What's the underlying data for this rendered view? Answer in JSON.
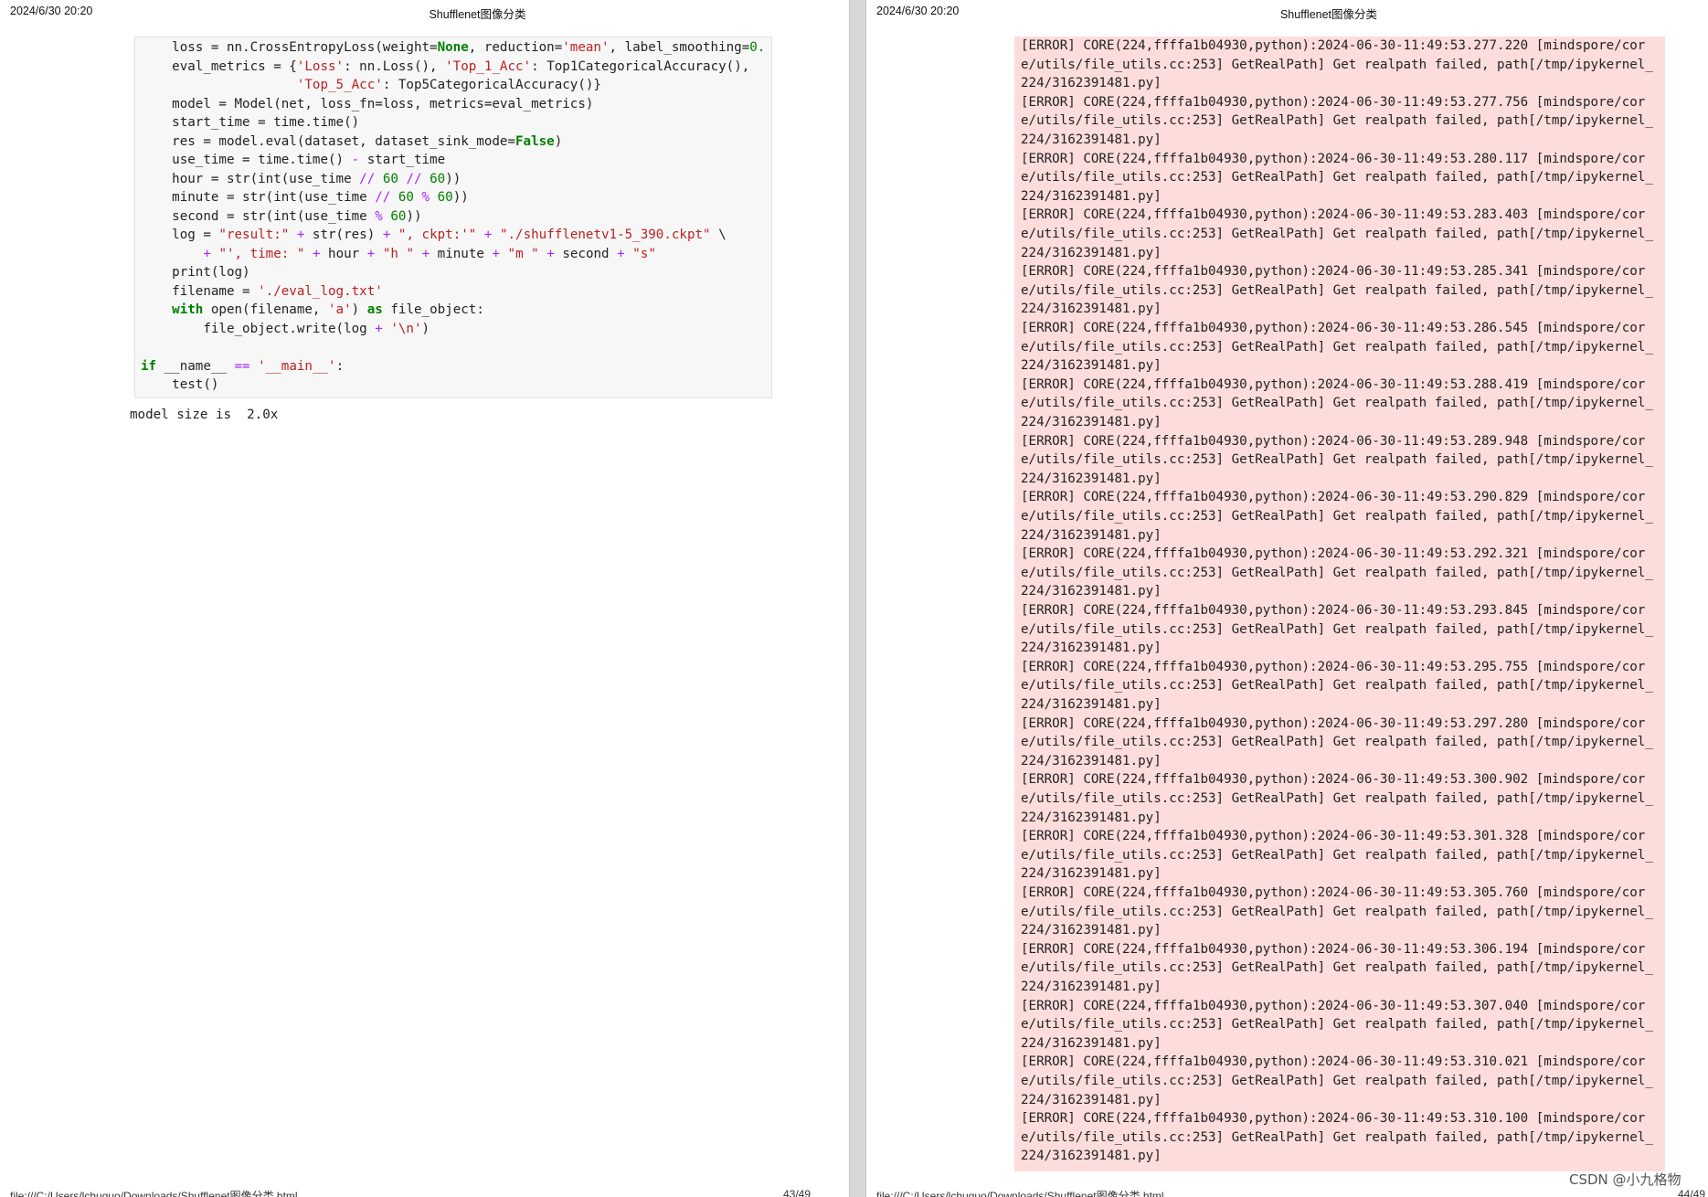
{
  "left_page": {
    "date": "2024/6/30 20:20",
    "title": "Shufflenet图像分类",
    "footer_url": "file:///C:/Users/lchuguo/Downloads/Shufflenet图像分类.html",
    "footer_page": "43/49",
    "code_lines": [
      [
        [
          "    loss = nn.CrossEntropyLoss(weight=",
          ""
        ],
        [
          "None",
          "kw"
        ],
        [
          ", reduction=",
          ""
        ],
        [
          "'mean'",
          "str"
        ],
        [
          ", label_smoothing=",
          ""
        ],
        [
          "0.",
          "num"
        ]
      ],
      [
        [
          "    eval_metrics = {",
          ""
        ],
        [
          "'Loss'",
          "str"
        ],
        [
          ": nn.Loss(), ",
          ""
        ],
        [
          "'Top_1_Acc'",
          "str"
        ],
        [
          ": Top1CategoricalAccuracy(),",
          ""
        ]
      ],
      [
        [
          "                    ",
          ""
        ],
        [
          "'Top_5_Acc'",
          "str"
        ],
        [
          ": Top5CategoricalAccuracy()}",
          ""
        ]
      ],
      [
        [
          "    model = Model(net, loss_fn=loss, metrics=eval_metrics)",
          ""
        ]
      ],
      [
        [
          "    start_time = time.time()",
          ""
        ]
      ],
      [
        [
          "    res = model.eval(dataset, dataset_sink_mode=",
          ""
        ],
        [
          "False",
          "kw"
        ],
        [
          ")",
          ""
        ]
      ],
      [
        [
          "    use_time = time.time() ",
          ""
        ],
        [
          "-",
          "op"
        ],
        [
          " start_time",
          ""
        ]
      ],
      [
        [
          "    hour = str(int(use_time ",
          ""
        ],
        [
          "//",
          "op"
        ],
        [
          " ",
          ""
        ],
        [
          "60",
          "num"
        ],
        [
          " ",
          ""
        ],
        [
          "//",
          "op"
        ],
        [
          " ",
          ""
        ],
        [
          "60",
          "num"
        ],
        [
          "))",
          ""
        ]
      ],
      [
        [
          "    minute = str(int(use_time ",
          ""
        ],
        [
          "//",
          "op"
        ],
        [
          " ",
          ""
        ],
        [
          "60",
          "num"
        ],
        [
          " ",
          ""
        ],
        [
          "%",
          "op"
        ],
        [
          " ",
          ""
        ],
        [
          "60",
          "num"
        ],
        [
          "))",
          ""
        ]
      ],
      [
        [
          "    second = str(int(use_time ",
          ""
        ],
        [
          "%",
          "op"
        ],
        [
          " ",
          ""
        ],
        [
          "60",
          "num"
        ],
        [
          "))",
          ""
        ]
      ],
      [
        [
          "    log = ",
          ""
        ],
        [
          "\"result:\"",
          "str"
        ],
        [
          " ",
          ""
        ],
        [
          "+",
          "op"
        ],
        [
          " str(res) ",
          ""
        ],
        [
          "+",
          "op"
        ],
        [
          " ",
          ""
        ],
        [
          "\", ckpt:'\"",
          "str"
        ],
        [
          " ",
          ""
        ],
        [
          "+",
          "op"
        ],
        [
          " ",
          ""
        ],
        [
          "\"./shufflenetv1-5_390.ckpt\"",
          "str"
        ],
        [
          " \\",
          ""
        ]
      ],
      [
        [
          "        ",
          ""
        ],
        [
          "+",
          "op"
        ],
        [
          " ",
          ""
        ],
        [
          "\"', time: \"",
          "str"
        ],
        [
          " ",
          ""
        ],
        [
          "+",
          "op"
        ],
        [
          " hour ",
          ""
        ],
        [
          "+",
          "op"
        ],
        [
          " ",
          ""
        ],
        [
          "\"h \"",
          "str"
        ],
        [
          " ",
          ""
        ],
        [
          "+",
          "op"
        ],
        [
          " minute ",
          ""
        ],
        [
          "+",
          "op"
        ],
        [
          " ",
          ""
        ],
        [
          "\"m \"",
          "str"
        ],
        [
          " ",
          ""
        ],
        [
          "+",
          "op"
        ],
        [
          " second ",
          ""
        ],
        [
          "+",
          "op"
        ],
        [
          " ",
          ""
        ],
        [
          "\"s\"",
          "str"
        ]
      ],
      [
        [
          "    print(log)",
          ""
        ]
      ],
      [
        [
          "    filename = ",
          ""
        ],
        [
          "'./eval_log.txt'",
          "str"
        ]
      ],
      [
        [
          "    ",
          ""
        ],
        [
          "with",
          "kw"
        ],
        [
          " open(filename, ",
          ""
        ],
        [
          "'a'",
          "str"
        ],
        [
          ") ",
          ""
        ],
        [
          "as",
          "kw"
        ],
        [
          " file_object:",
          ""
        ]
      ],
      [
        [
          "        file_object.write(log ",
          ""
        ],
        [
          "+",
          "op"
        ],
        [
          " ",
          ""
        ],
        [
          "'\\n'",
          "str"
        ],
        [
          ")",
          ""
        ]
      ],
      [
        [
          "",
          ""
        ]
      ],
      [
        [
          "if",
          "kw"
        ],
        [
          " __name__ ",
          ""
        ],
        [
          "==",
          "op"
        ],
        [
          " ",
          ""
        ],
        [
          "'__main__'",
          "str"
        ],
        [
          ":",
          ""
        ]
      ],
      [
        [
          "    test()",
          ""
        ]
      ]
    ],
    "output_text": "model size is  2.0x"
  },
  "right_page": {
    "date": "2024/6/30 20:20",
    "title": "Shufflenet图像分类",
    "footer_url": "file:///C:/Users/lchuguo/Downloads/Shufflenet图像分类.html",
    "footer_page": "44/49",
    "error_lines": [
      "[ERROR] CORE(224,ffffa1b04930,python):2024-06-30-11:49:53.277.220 [mindspore/cor",
      "e/utils/file_utils.cc:253] GetRealPath] Get realpath failed, path[/tmp/ipykernel_",
      "224/3162391481.py]",
      "[ERROR] CORE(224,ffffa1b04930,python):2024-06-30-11:49:53.277.756 [mindspore/cor",
      "e/utils/file_utils.cc:253] GetRealPath] Get realpath failed, path[/tmp/ipykernel_",
      "224/3162391481.py]",
      "[ERROR] CORE(224,ffffa1b04930,python):2024-06-30-11:49:53.280.117 [mindspore/cor",
      "e/utils/file_utils.cc:253] GetRealPath] Get realpath failed, path[/tmp/ipykernel_",
      "224/3162391481.py]",
      "[ERROR] CORE(224,ffffa1b04930,python):2024-06-30-11:49:53.283.403 [mindspore/cor",
      "e/utils/file_utils.cc:253] GetRealPath] Get realpath failed, path[/tmp/ipykernel_",
      "224/3162391481.py]",
      "[ERROR] CORE(224,ffffa1b04930,python):2024-06-30-11:49:53.285.341 [mindspore/cor",
      "e/utils/file_utils.cc:253] GetRealPath] Get realpath failed, path[/tmp/ipykernel_",
      "224/3162391481.py]",
      "[ERROR] CORE(224,ffffa1b04930,python):2024-06-30-11:49:53.286.545 [mindspore/cor",
      "e/utils/file_utils.cc:253] GetRealPath] Get realpath failed, path[/tmp/ipykernel_",
      "224/3162391481.py]",
      "[ERROR] CORE(224,ffffa1b04930,python):2024-06-30-11:49:53.288.419 [mindspore/cor",
      "e/utils/file_utils.cc:253] GetRealPath] Get realpath failed, path[/tmp/ipykernel_",
      "224/3162391481.py]",
      "[ERROR] CORE(224,ffffa1b04930,python):2024-06-30-11:49:53.289.948 [mindspore/cor",
      "e/utils/file_utils.cc:253] GetRealPath] Get realpath failed, path[/tmp/ipykernel_",
      "224/3162391481.py]",
      "[ERROR] CORE(224,ffffa1b04930,python):2024-06-30-11:49:53.290.829 [mindspore/cor",
      "e/utils/file_utils.cc:253] GetRealPath] Get realpath failed, path[/tmp/ipykernel_",
      "224/3162391481.py]",
      "[ERROR] CORE(224,ffffa1b04930,python):2024-06-30-11:49:53.292.321 [mindspore/cor",
      "e/utils/file_utils.cc:253] GetRealPath] Get realpath failed, path[/tmp/ipykernel_",
      "224/3162391481.py]",
      "[ERROR] CORE(224,ffffa1b04930,python):2024-06-30-11:49:53.293.845 [mindspore/cor",
      "e/utils/file_utils.cc:253] GetRealPath] Get realpath failed, path[/tmp/ipykernel_",
      "224/3162391481.py]",
      "[ERROR] CORE(224,ffffa1b04930,python):2024-06-30-11:49:53.295.755 [mindspore/cor",
      "e/utils/file_utils.cc:253] GetRealPath] Get realpath failed, path[/tmp/ipykernel_",
      "224/3162391481.py]",
      "[ERROR] CORE(224,ffffa1b04930,python):2024-06-30-11:49:53.297.280 [mindspore/cor",
      "e/utils/file_utils.cc:253] GetRealPath] Get realpath failed, path[/tmp/ipykernel_",
      "224/3162391481.py]",
      "[ERROR] CORE(224,ffffa1b04930,python):2024-06-30-11:49:53.300.902 [mindspore/cor",
      "e/utils/file_utils.cc:253] GetRealPath] Get realpath failed, path[/tmp/ipykernel_",
      "224/3162391481.py]",
      "[ERROR] CORE(224,ffffa1b04930,python):2024-06-30-11:49:53.301.328 [mindspore/cor",
      "e/utils/file_utils.cc:253] GetRealPath] Get realpath failed, path[/tmp/ipykernel_",
      "224/3162391481.py]",
      "[ERROR] CORE(224,ffffa1b04930,python):2024-06-30-11:49:53.305.760 [mindspore/cor",
      "e/utils/file_utils.cc:253] GetRealPath] Get realpath failed, path[/tmp/ipykernel_",
      "224/3162391481.py]",
      "[ERROR] CORE(224,ffffa1b04930,python):2024-06-30-11:49:53.306.194 [mindspore/cor",
      "e/utils/file_utils.cc:253] GetRealPath] Get realpath failed, path[/tmp/ipykernel_",
      "224/3162391481.py]",
      "[ERROR] CORE(224,ffffa1b04930,python):2024-06-30-11:49:53.307.040 [mindspore/cor",
      "e/utils/file_utils.cc:253] GetRealPath] Get realpath failed, path[/tmp/ipykernel_",
      "224/3162391481.py]",
      "[ERROR] CORE(224,ffffa1b04930,python):2024-06-30-11:49:53.310.021 [mindspore/cor",
      "e/utils/file_utils.cc:253] GetRealPath] Get realpath failed, path[/tmp/ipykernel_",
      "224/3162391481.py]",
      "[ERROR] CORE(224,ffffa1b04930,python):2024-06-30-11:49:53.310.100 [mindspore/cor",
      "e/utils/file_utils.cc:253] GetRealPath] Get realpath failed, path[/tmp/ipykernel_",
      "224/3162391481.py]"
    ]
  },
  "watermark": "CSDN @小九格物"
}
